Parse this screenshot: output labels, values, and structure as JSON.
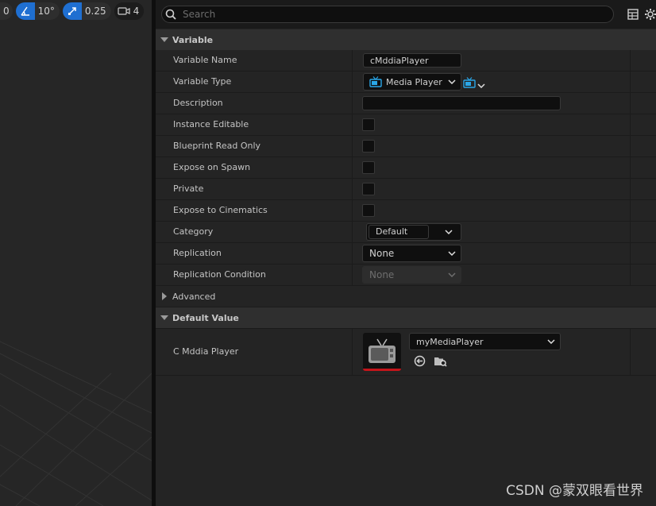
{
  "viewport_toolbar": {
    "edge_value": "0",
    "angle_snap": "10°",
    "scale_snap": "0.25",
    "camera_speed": "4"
  },
  "search": {
    "placeholder": "Search"
  },
  "sections": {
    "variable": "Variable",
    "advanced": "Advanced",
    "default_value": "Default Value"
  },
  "properties": {
    "variable_name": {
      "label": "Variable Name",
      "value": "cMddiaPlayer"
    },
    "variable_type": {
      "label": "Variable Type",
      "value": "Media Player"
    },
    "description": {
      "label": "Description",
      "value": ""
    },
    "instance_editable": {
      "label": "Instance Editable",
      "checked": false
    },
    "blueprint_read_only": {
      "label": "Blueprint Read Only",
      "checked": false
    },
    "expose_on_spawn": {
      "label": "Expose on Spawn",
      "checked": false
    },
    "private": {
      "label": "Private",
      "checked": false
    },
    "expose_to_cinematics": {
      "label": "Expose to Cinematics",
      "checked": false
    },
    "category": {
      "label": "Category",
      "value": "Default"
    },
    "replication": {
      "label": "Replication",
      "value": "None"
    },
    "replication_condition": {
      "label": "Replication Condition",
      "value": "None"
    }
  },
  "default_value": {
    "label": "C Mddia Player",
    "asset": "myMediaPlayer"
  },
  "colors": {
    "accent_blue": "#1f6fd1",
    "media_type_icon": "#2aa7e8",
    "thumbnail_bar": "#c4151b"
  },
  "watermark": "CSDN @蒙双眼看世界"
}
